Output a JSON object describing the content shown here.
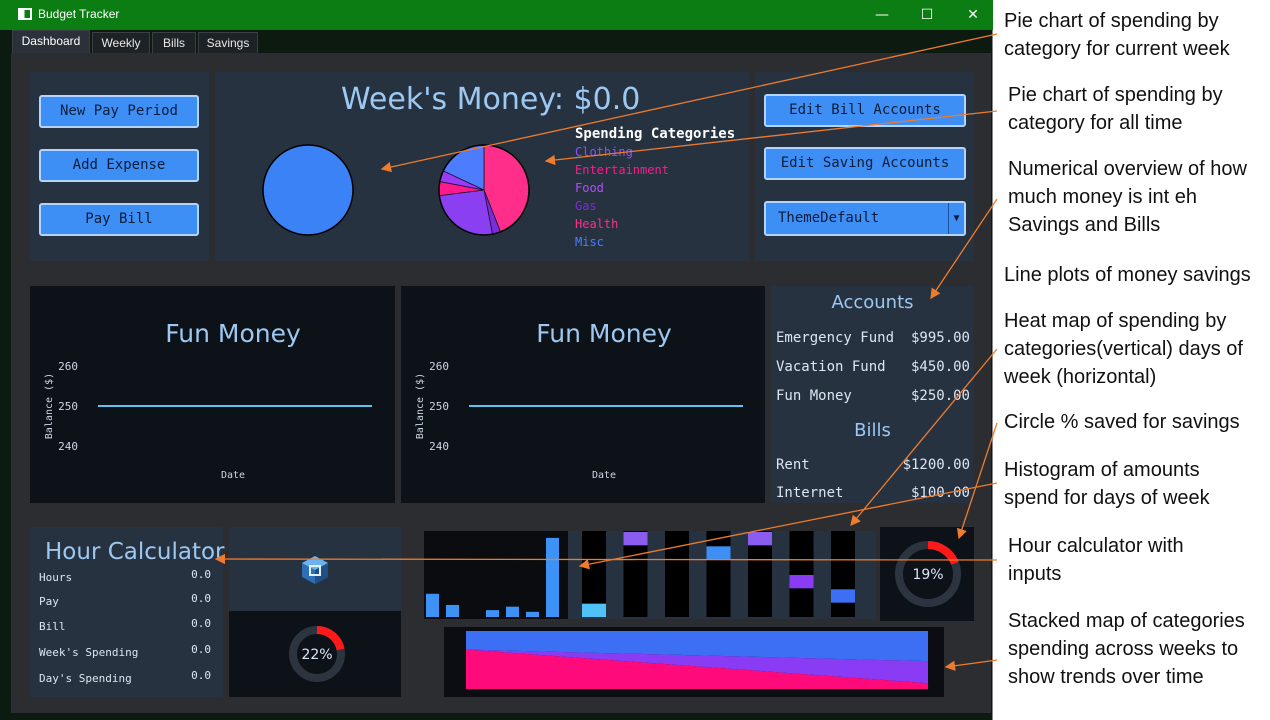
{
  "window": {
    "title": "Budget Tracker",
    "minimize_glyph": "—",
    "maximize_glyph": "☐",
    "close_glyph": "✕"
  },
  "tabs": [
    {
      "label": "Dashboard",
      "active": true
    },
    {
      "label": "Weekly",
      "active": false
    },
    {
      "label": "Bills",
      "active": false
    },
    {
      "label": "Savings",
      "active": false
    }
  ],
  "actions": {
    "new_pay_period": "New Pay Period",
    "add_expense": "Add Expense",
    "pay_bill": "Pay Bill",
    "edit_bill_accounts": "Edit Bill Accounts",
    "edit_saving_accounts": "Edit Saving Accounts",
    "theme_select_value": "ThemeDefault"
  },
  "header": {
    "weeks_money": "Week's Money: $0.0"
  },
  "legend": {
    "title": "Spending Categories",
    "items": [
      {
        "label": "Clothing",
        "color": "#8e4dff"
      },
      {
        "label": "Entertainment",
        "color": "#ff1a8c"
      },
      {
        "label": "Food",
        "color": "#b24dff"
      },
      {
        "label": "Gas",
        "color": "#7a2cd6"
      },
      {
        "label": "Health",
        "color": "#ff2e88"
      },
      {
        "label": "Misc",
        "color": "#4d7cff"
      }
    ]
  },
  "chart_data": [
    {
      "type": "pie",
      "name_ref": "current-week-pie",
      "categories": [
        "Misc"
      ],
      "values": [
        1
      ],
      "colors": [
        "#3b82f6"
      ]
    },
    {
      "type": "pie",
      "name_ref": "all-time-pie",
      "categories": [
        "Clothing",
        "Entertainment",
        "Food",
        "Gas",
        "Health",
        "Misc"
      ],
      "values": [
        0.44,
        0.03,
        0.26,
        0.05,
        0.04,
        0.18
      ],
      "colors": [
        "#ff2e8a",
        "#7a2cd6",
        "#8a40f0",
        "#ff1a8c",
        "#9a3cf5",
        "#4d7cff"
      ]
    },
    {
      "type": "line",
      "title": "Fun Money",
      "xlabel": "Date",
      "ylabel": "Balance ($)",
      "ylim": [
        235,
        265
      ],
      "yticks": [
        240,
        250,
        260
      ],
      "series": [
        {
          "values": [
            250,
            250
          ]
        }
      ]
    },
    {
      "type": "line",
      "title": "Fun Money",
      "xlabel": "Date",
      "ylabel": "Balance ($)",
      "ylim": [
        235,
        265
      ],
      "yticks": [
        240,
        250,
        260
      ],
      "series": [
        {
          "values": [
            250,
            250
          ]
        }
      ]
    },
    {
      "type": "bar",
      "name_ref": "spending-histogram",
      "values": [
        0.27,
        0.14,
        0,
        0.08,
        0.12,
        0.06,
        0.92
      ],
      "color": "#3d93f5"
    },
    {
      "type": "heatmap",
      "name_ref": "spending-heatmap",
      "columns": 7,
      "rows": 6,
      "cells": [
        {
          "col": 0,
          "row": 5,
          "color": "#4fc3f7"
        },
        {
          "col": 1,
          "row": 0,
          "color": "#8a5cf0"
        },
        {
          "col": 3,
          "row": 1,
          "color": "#3d8ef5"
        },
        {
          "col": 4,
          "row": 0,
          "color": "#8a5cf0"
        },
        {
          "col": 5,
          "row": 3,
          "color": "#8a3cf5"
        },
        {
          "col": 6,
          "row": 4,
          "color": "#3d6ff5"
        }
      ]
    },
    {
      "type": "area",
      "name_ref": "stacked-categories",
      "x": [
        0,
        1
      ],
      "series": [
        {
          "values": [
            0.68,
            0.1
          ],
          "color": "#ff0a7a"
        },
        {
          "values": [
            0.0,
            0.38
          ],
          "color": "#8a3cf5"
        },
        {
          "values": [
            0.32,
            0.52
          ],
          "color": "#3d6ff5"
        }
      ]
    }
  ],
  "savings_circle_right": {
    "percent_label": "19%",
    "fraction": 0.19
  },
  "savings_circle_left": {
    "percent_label": "22%",
    "fraction": 0.22
  },
  "accounts": {
    "title": "Accounts",
    "rows": [
      {
        "name": "Emergency Fund",
        "amount": "$995.00"
      },
      {
        "name": "Vacation Fund",
        "amount": "$450.00"
      },
      {
        "name": "Fun Money",
        "amount": "$250.00"
      }
    ]
  },
  "bills": {
    "title": "Bills",
    "rows": [
      {
        "name": "Rent",
        "amount": "$1200.00"
      },
      {
        "name": "Internet",
        "amount": "$100.00"
      }
    ]
  },
  "hour_calculator": {
    "title": "Hour Calculator",
    "rows": [
      {
        "label": "Hours",
        "value": "0.0"
      },
      {
        "label": "Pay",
        "value": "0.0"
      },
      {
        "label": "Bill",
        "value": "0.0"
      },
      {
        "label": "Week's Spending",
        "value": "0.0"
      },
      {
        "label": "Day's Spending",
        "value": "0.0"
      }
    ]
  },
  "annotations": [
    "Pie chart of spending by category for current week",
    "Pie chart of spending by category for all time",
    "Numerical overview of how much money is int eh Savings and Bills",
    "Line plots of money savings",
    "Heat map of spending by categories(vertical) days of week (horizontal)",
    "Circle % saved for savings",
    "Histogram of amounts spend for days of week",
    "Hour calculator with inputs",
    "Stacked map of categories spending across weeks to show trends over time"
  ]
}
